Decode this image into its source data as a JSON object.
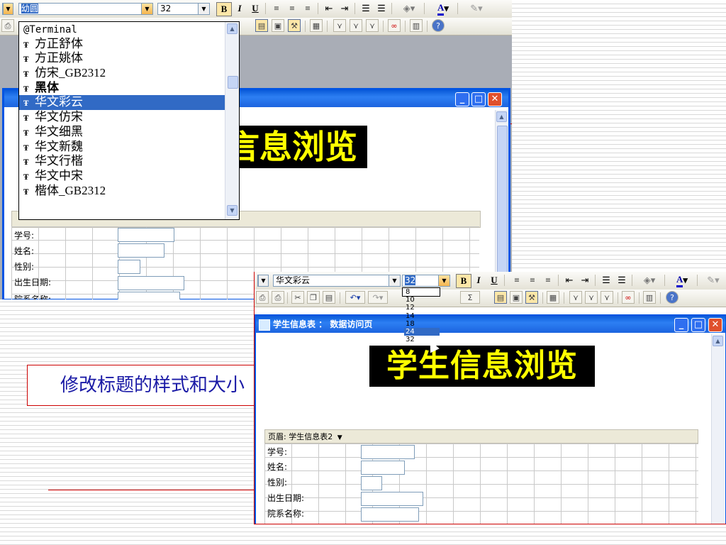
{
  "window_title": "学生信息表 ： 数据访问页",
  "page_title": "学生信息浏览",
  "page_title_fragment": "言息浏览",
  "caption": "修改标题的样式和大小",
  "toolbar": {
    "bold": "B",
    "italic": "I",
    "underline": "U",
    "font_color_letter": "A",
    "sigma": "Σ"
  },
  "top_panel": {
    "font_name_value": "幼圆",
    "font_size_value": "32",
    "font_options": [
      {
        "label": "@Terminal",
        "selected": false
      },
      {
        "label": "方正舒体",
        "selected": false
      },
      {
        "label": "方正姚体",
        "selected": false
      },
      {
        "label": "仿宋_GB2312",
        "selected": false
      },
      {
        "label": "黑体",
        "selected": false
      },
      {
        "label": "华文彩云",
        "selected": true
      },
      {
        "label": "华文仿宋",
        "selected": false
      },
      {
        "label": "华文细黑",
        "selected": false
      },
      {
        "label": "华文新魏",
        "selected": false
      },
      {
        "label": "华文行楷",
        "selected": false
      },
      {
        "label": "华文中宋",
        "selected": false
      },
      {
        "label": "楷体_GB2312",
        "selected": false
      }
    ],
    "fields": [
      "学号:",
      "姓名:",
      "性别:",
      "出生日期:",
      "院系名称:"
    ]
  },
  "bottom_panel": {
    "font_name_value": "华文彩云",
    "font_size_value": "32",
    "size_options": [
      {
        "label": "8",
        "selected": false
      },
      {
        "label": "10",
        "selected": false
      },
      {
        "label": "12",
        "selected": false
      },
      {
        "label": "14",
        "selected": false
      },
      {
        "label": "18",
        "selected": false
      },
      {
        "label": "24",
        "selected": true
      },
      {
        "label": "32",
        "selected": false
      }
    ],
    "section_header": "页眉: 学生信息表2",
    "fields": [
      "学号:",
      "姓名:",
      "性别:",
      "出生日期:",
      "院系名称:"
    ]
  },
  "colors": {
    "title_bar": "#0a5bd9",
    "selection": "#316ac5",
    "banner_text": "#ffff00",
    "caption_text": "#1a1aa6",
    "caption_border": "#cc0000"
  }
}
